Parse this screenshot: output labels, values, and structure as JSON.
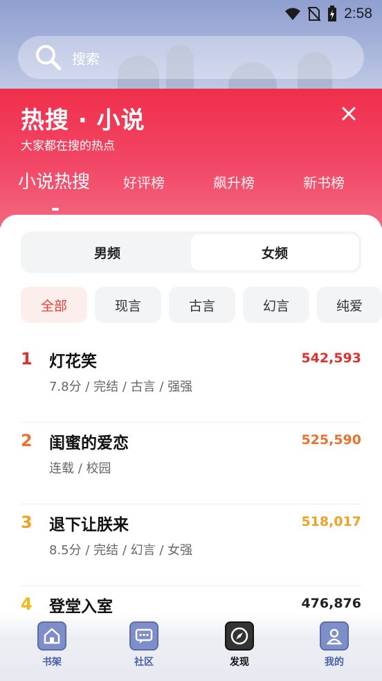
{
  "status_bar": {
    "time": "2:58",
    "icons": [
      "wifi-icon",
      "no-sim-icon",
      "battery-charging-icon"
    ]
  },
  "search": {
    "placeholder": "搜索",
    "icon": "search-icon"
  },
  "hot_header": {
    "title": "热搜 · 小说",
    "subtitle": "大家都在搜的热点",
    "close_icon": "close-icon",
    "tabs": [
      {
        "label": "小说热搜",
        "active": true
      },
      {
        "label": "好评榜",
        "active": false
      },
      {
        "label": "飙升榜",
        "active": false
      },
      {
        "label": "新书榜",
        "active": false
      }
    ]
  },
  "gender_toggle": {
    "options": [
      {
        "label": "男频",
        "selected": false
      },
      {
        "label": "女频",
        "selected": true
      }
    ]
  },
  "categories": [
    {
      "label": "全部",
      "active": true
    },
    {
      "label": "现言",
      "active": false
    },
    {
      "label": "古言",
      "active": false
    },
    {
      "label": "幻言",
      "active": false
    },
    {
      "label": "纯爱",
      "active": false
    }
  ],
  "ranking": [
    {
      "rank": "1",
      "title": "灯花笑",
      "meta": "7.8分 / 完结 / 古言 / 强强",
      "score": "542,593",
      "color": "#e02f2f"
    },
    {
      "rank": "2",
      "title": "闺蜜的爱恋",
      "meta": "连载 / 校园",
      "score": "525,590",
      "color": "#e8722e"
    },
    {
      "rank": "3",
      "title": "退下让朕来",
      "meta": "8.5分 / 完结 / 幻言 / 女强",
      "score": "518,017",
      "color": "#eea224"
    },
    {
      "rank": "4",
      "title": "登堂入室",
      "meta": "",
      "score": "476,876",
      "color": "#f0b81c"
    }
  ],
  "bottom_nav": [
    {
      "label": "书架",
      "icon": "bookshelf-home-icon",
      "active": false
    },
    {
      "label": "社区",
      "icon": "community-chat-icon",
      "active": false
    },
    {
      "label": "发现",
      "icon": "discover-compass-icon",
      "active": true
    },
    {
      "label": "我的",
      "icon": "profile-user-icon",
      "active": false
    }
  ],
  "colors": {
    "accent_red": "#ef2f4b",
    "nav_blue": "#7e8ec9"
  }
}
